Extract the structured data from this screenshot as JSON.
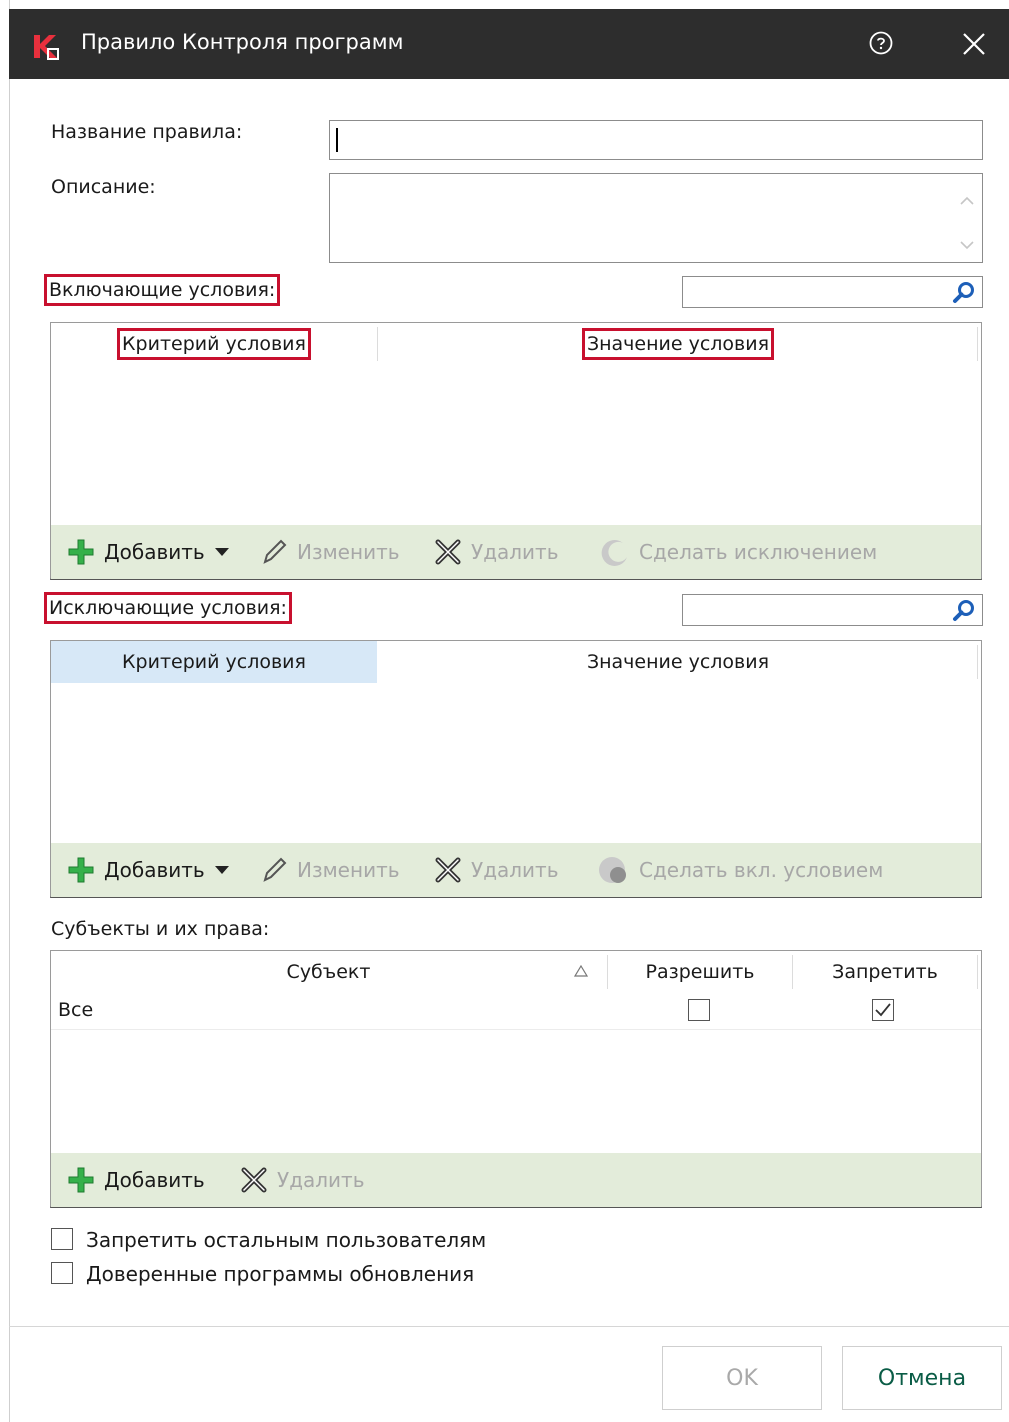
{
  "window": {
    "title": "Правило Контроля программ"
  },
  "form": {
    "rule_name_label": "Название правила:",
    "rule_name_value": "",
    "description_label": "Описание:",
    "description_value": ""
  },
  "include": {
    "label": "Включающие условия:",
    "columns": [
      "Критерий условия",
      "Значение условия"
    ],
    "toolbar": {
      "add": "Добавить",
      "edit": "Изменить",
      "delete": "Удалить",
      "special": "Сделать исключением"
    }
  },
  "exclude": {
    "label": "Исключающие условия:",
    "columns": [
      "Критерий условия",
      "Значение условия"
    ],
    "toolbar": {
      "add": "Добавить",
      "edit": "Изменить",
      "delete": "Удалить",
      "special": "Сделать вкл. условием"
    }
  },
  "subjects": {
    "label": "Субъекты и их права:",
    "columns": [
      "Субъект",
      "Разрешить",
      "Запретить"
    ],
    "rows": [
      {
        "subject": "Все",
        "allow": false,
        "deny": true
      }
    ],
    "toolbar": {
      "add": "Добавить",
      "delete": "Удалить"
    }
  },
  "options": {
    "deny_others": {
      "label": "Запретить остальным пользователям",
      "checked": false
    },
    "trusted_updaters": {
      "label": "Доверенные программы обновления",
      "checked": false
    }
  },
  "buttons": {
    "ok": "OK",
    "cancel": "Отмена"
  },
  "colors": {
    "titlebar": "#2d2d2d",
    "accent_red": "#c8102e",
    "toolbar_bg": "#e3ecda",
    "add_green": "#2fa84f",
    "cancel_text": "#0a5c46"
  }
}
